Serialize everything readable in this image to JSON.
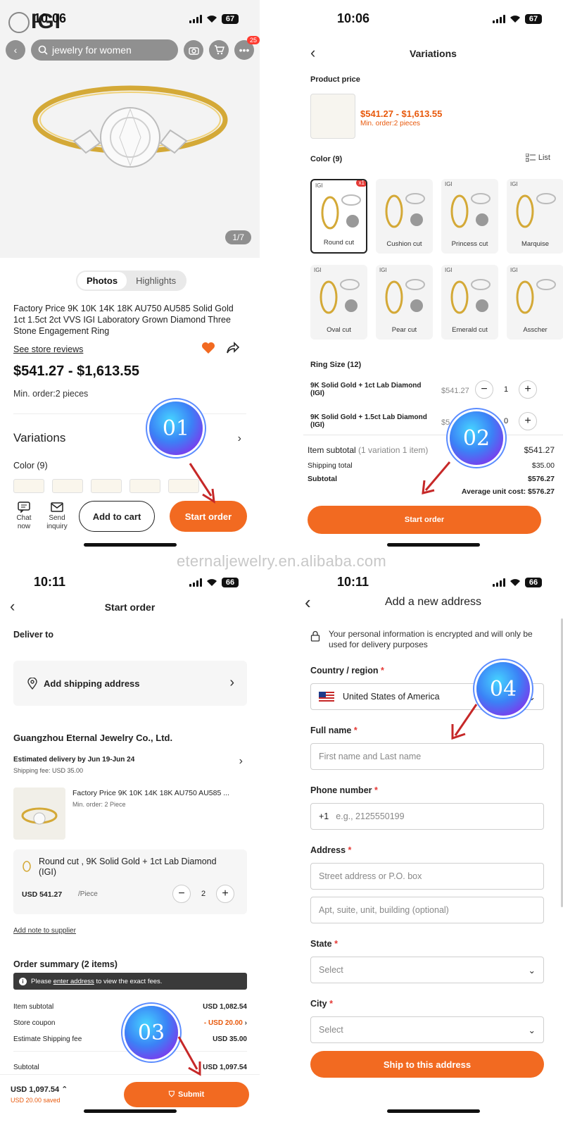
{
  "watermark": "eternaljewelry.en.alibaba.com",
  "screen1": {
    "status": {
      "time": "10:06",
      "battery": "67"
    },
    "logo": "IGI",
    "search_placeholder": "jewelry for women",
    "notifications": "25",
    "image_counter": "1/7",
    "tabs": [
      "Photos",
      "Highlights"
    ],
    "title": "Factory Price 9K 10K 14K 18K AU750 AU585 Solid Gold 1ct 1.5ct 2ct VVS IGI Laboratory Grown Diamond Three Stone Engagement Ring",
    "reviews_link": "See store reviews",
    "price": "$541.27 - $1,613.55",
    "min_order": "Min. order:2 pieces",
    "variations_label": "Variations",
    "color_label": "Color (9)",
    "chat_label": "Chat now",
    "inquiry_label": "Send inquiry",
    "add_to_cart": "Add to cart",
    "start_order": "Start order",
    "step": "01"
  },
  "screen2": {
    "status": {
      "time": "10:06",
      "battery": "67"
    },
    "title": "Variations",
    "product_price_label": "Product price",
    "price": "$541.27 - $1,613.55",
    "min_order": "Min. order:2 pieces",
    "color_label": "Color (9)",
    "list_label": "List",
    "cuts_row1": [
      "Round cut",
      "Cushion cut",
      "Princess cut",
      "Marquise"
    ],
    "cuts_row2": [
      "Oval cut",
      "Pear cut",
      "Emerald cut",
      "Asscher"
    ],
    "selected_badge": "x1",
    "ring_size_label": "Ring Size (12)",
    "sizes": [
      {
        "name": "9K Solid Gold + 1ct Lab Diamond (IGI)",
        "price": "$541.27",
        "qty": "1"
      },
      {
        "name": "9K Solid Gold + 1.5ct Lab Diamond (IGI)",
        "price": "$5..",
        "qty": "0"
      }
    ],
    "item_subtotal_label": "Item subtotal",
    "item_subtotal_note": "(1 variation 1 item)",
    "item_subtotal": "$541.27",
    "shipping_label": "Shipping total",
    "shipping": "$35.00",
    "subtotal_label": "Subtotal",
    "subtotal": "$576.27",
    "avg_cost": "Average unit cost: $576.27",
    "start_order": "Start order",
    "step": "02"
  },
  "screen3": {
    "status": {
      "time": "10:11",
      "battery": "66"
    },
    "title": "Start order",
    "deliver_to": "Deliver to",
    "add_address": "Add shipping address",
    "supplier": "Guangzhou Eternal Jewelry Co., Ltd.",
    "est_delivery": "Estimated delivery by Jun 19-Jun 24",
    "shipping_fee": "Shipping fee: USD 35.00",
    "product_name": "Factory Price 9K 10K 14K 18K AU750 AU585 ...",
    "product_min": "Min. order: 2 Piece",
    "variant_name": "Round cut , 9K Solid Gold + 1ct Lab Diamond (IGI)",
    "variant_price": "USD 541.27",
    "variant_unit": "/Piece",
    "variant_qty": "2",
    "add_note": "Add note to supplier",
    "order_summary": "Order summary (2 items)",
    "info_prefix": "Please",
    "info_link": "enter address",
    "info_suffix": "to view the exact fees.",
    "rows": [
      {
        "label": "Item subtotal",
        "value": "USD 1,082.54"
      },
      {
        "label": "Store coupon",
        "value": "- USD 20.00"
      },
      {
        "label": "Estimate Shipping fee",
        "value": "USD 35.00"
      },
      {
        "label": "Subtotal",
        "value": "USD 1,097.54"
      }
    ],
    "total": "USD 1,097.54",
    "saved": "USD 20.00 saved",
    "submit": "Submit",
    "step": "03"
  },
  "screen4": {
    "status": {
      "time": "10:11",
      "battery": "66"
    },
    "title": "Add a new address",
    "privacy": "Your personal information is encrypted and will only be used for delivery purposes",
    "country_label": "Country / region",
    "country_value": "United States of America",
    "fullname_label": "Full name",
    "fullname_placeholder": "First name and Last name",
    "phone_label": "Phone number",
    "phone_code": "+1",
    "phone_placeholder": "e.g., 2125550199",
    "address_label": "Address",
    "street_placeholder": "Street address or P.O. box",
    "apt_placeholder": "Apt, suite, unit, building (optional)",
    "state_label": "State",
    "state_placeholder": "Select",
    "city_label": "City",
    "city_placeholder": "Select",
    "ship_button": "Ship to this address",
    "step": "04"
  },
  "colors": {
    "accent": "#f26a21",
    "price": "#e8590c",
    "required": "#e53935"
  }
}
